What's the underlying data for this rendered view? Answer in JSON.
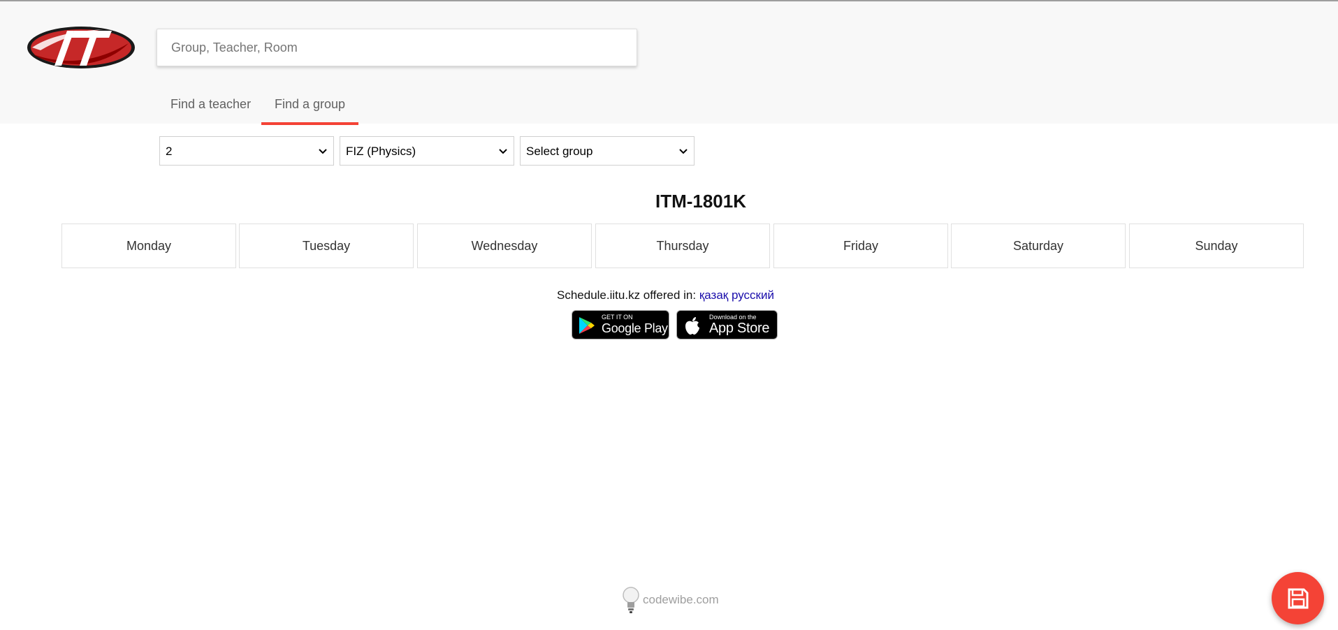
{
  "header": {
    "logo_text": "IT",
    "search": {
      "placeholder": "Group, Teacher, Room",
      "value": ""
    },
    "tabs": [
      {
        "label": "Find a teacher",
        "active": false
      },
      {
        "label": "Find a group",
        "active": true
      }
    ]
  },
  "filters": {
    "course": "2",
    "specialty": "FIZ (Physics)",
    "group": "Select group"
  },
  "group_title": "ITM-1801K",
  "days": [
    "Monday",
    "Tuesday",
    "Wednesday",
    "Thursday",
    "Friday",
    "Saturday",
    "Sunday"
  ],
  "languages": {
    "prefix": "Schedule.iitu.kz offered in:",
    "links": [
      "қазақ",
      "русский"
    ]
  },
  "stores": {
    "google": {
      "small": "GET IT ON",
      "big": "Google Play"
    },
    "apple": {
      "small": "Download on the",
      "big": "App Store"
    }
  },
  "credit": "codewibe.com",
  "colors": {
    "accent": "#f44336",
    "link": "#1a0dab",
    "header_bg": "#f8f8f8"
  },
  "fab_icon": "save-icon"
}
